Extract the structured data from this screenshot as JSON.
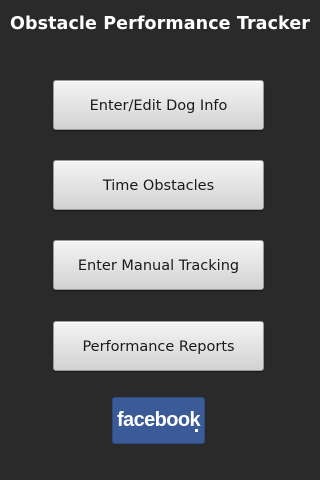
{
  "app": {
    "title": "Obstacle Performance Tracker"
  },
  "menu": {
    "items": [
      {
        "label": "Enter/Edit Dog Info"
      },
      {
        "label": "Time Obstacles"
      },
      {
        "label": "Enter Manual Tracking"
      },
      {
        "label": "Performance Reports"
      }
    ]
  },
  "social": {
    "facebook_logo_text": "facebook",
    "facebook_color": "#3b5a98",
    "icon": "facebook-icon"
  },
  "theme": {
    "background": "#2a2a2a",
    "button_face": "#e2e2e2",
    "title_color": "#ffffff"
  }
}
